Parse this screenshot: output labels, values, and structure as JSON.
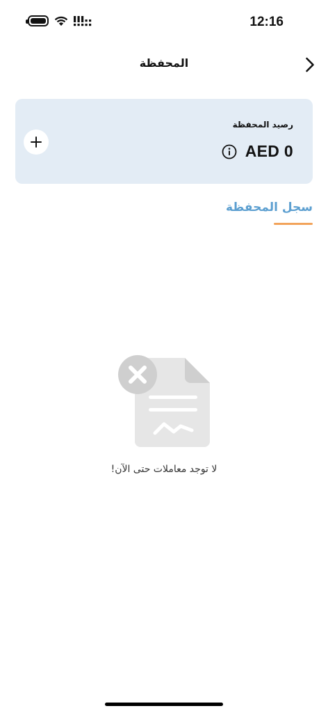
{
  "status_bar": {
    "time": "12:16",
    "battery_icon": "battery-icon",
    "wifi_icon": "wifi-icon",
    "signal_icon": "signal-icon"
  },
  "header": {
    "title": "المحفظة",
    "back_icon": "chevron-right-icon"
  },
  "balance_card": {
    "label": "رصيد المحفظة",
    "amount": "AED 0",
    "info_icon": "info-icon",
    "add_icon": "plus-icon",
    "background": "#e3ecf5"
  },
  "tabs": [
    {
      "label": "سجل المحفظة",
      "active": true
    }
  ],
  "colors": {
    "tab_active_text": "#5c9fd0",
    "tab_indicator": "#f2a35a",
    "illustration_gray": "#cfcfcf"
  },
  "empty_state": {
    "icon": "no-transactions-document-icon",
    "message": "لا توجد معاملات حتى الآن!"
  }
}
